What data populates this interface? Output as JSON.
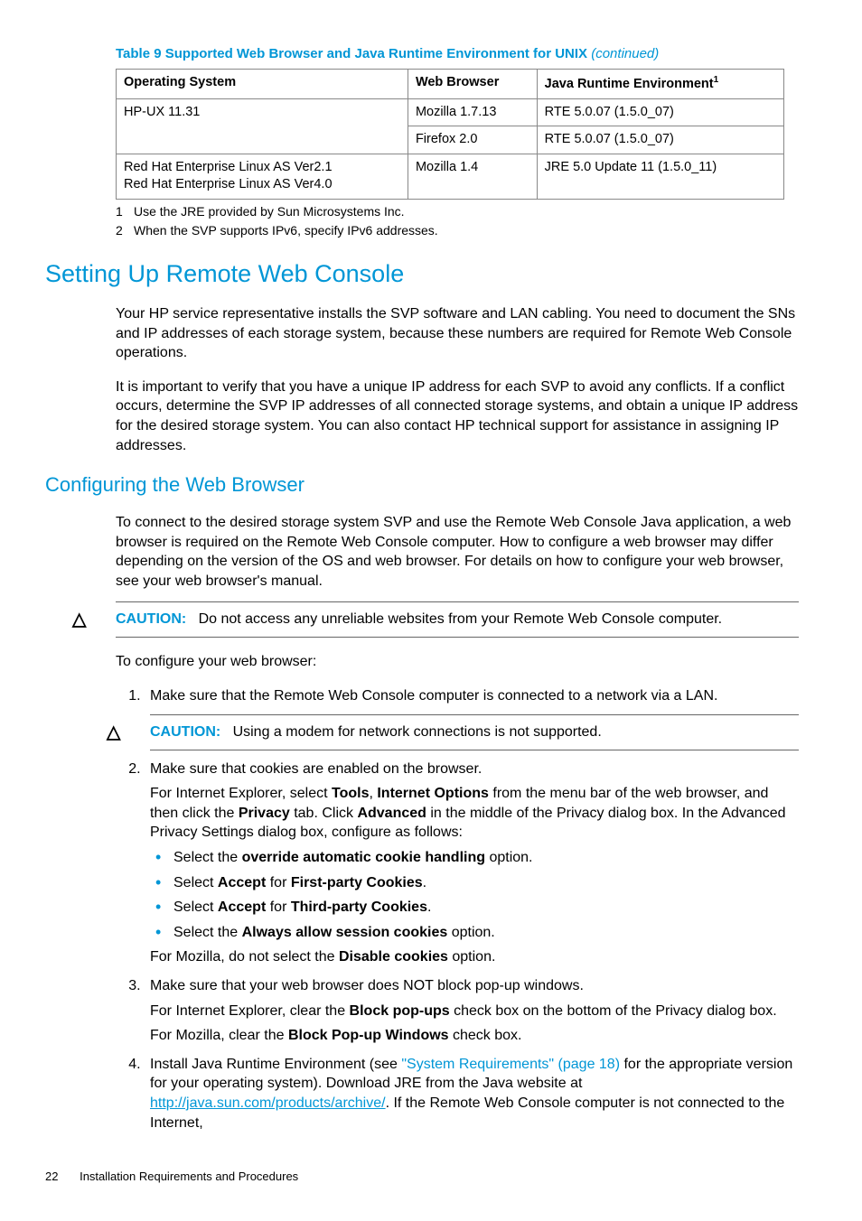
{
  "table": {
    "title": "Table 9 Supported Web Browser and Java Runtime Environment for UNIX",
    "continued": "(continued)",
    "headers": {
      "os": "Operating System",
      "browser": "Web Browser",
      "jre": "Java Runtime Environment",
      "jre_sup": "1"
    },
    "rows": {
      "r1_os": "HP-UX 11.31",
      "r1_browser": "Mozilla 1.7.13",
      "r1_jre": "RTE 5.0.07 (1.5.0_07)",
      "r2_browser": "Firefox 2.0",
      "r2_jre": "RTE 5.0.07 (1.5.0_07)",
      "r3_os_a": "Red Hat Enterprise Linux AS Ver2.1",
      "r3_os_b": "Red Hat Enterprise Linux AS Ver4.0",
      "r3_browser": "Mozilla 1.4",
      "r3_jre": "JRE 5.0 Update 11 (1.5.0_11)"
    }
  },
  "footnotes": {
    "n1": "1",
    "t1": "Use the JRE provided by Sun Microsystems Inc.",
    "n2": "2",
    "t2": "When the SVP supports IPv6, specify IPv6 addresses."
  },
  "h1": "Setting Up Remote Web Console",
  "para1": "Your HP service representative installs the SVP software and LAN cabling. You need to document the SNs and IP addresses of each storage system, because these numbers are required for Remote Web Console operations.",
  "para2": "It is important to verify that you have a unique IP address for each SVP to avoid any conflicts. If a conflict occurs, determine the SVP IP addresses of all connected storage systems, and obtain a unique IP address for the desired storage system. You can also contact HP technical support for assistance in assigning IP addresses.",
  "h2": "Configuring the Web Browser",
  "para3": "To connect to the desired storage system SVP and use the Remote Web Console Java application, a web browser is required on the Remote Web Console computer. How to configure a web browser may differ depending on the version of the OS and web browser. For details on how to configure your web browser, see your web browser's manual.",
  "caution": {
    "label": "CAUTION:",
    "text1": "Do not access any unreliable websites from your Remote Web Console computer.",
    "text2": "Using a modem for network connections is not supported."
  },
  "para4": "To configure your web browser:",
  "steps": {
    "s1": "Make sure that the Remote Web Console computer is connected to a network via a LAN.",
    "s2": "Make sure that cookies are enabled on the browser.",
    "s2_p1a": "For Internet Explorer, select ",
    "s2_p1b_tools": "Tools",
    "s2_p1c": ", ",
    "s2_p1d_io": "Internet Options",
    "s2_p1e": " from the menu bar of the web browser, and then click the ",
    "s2_p1f_priv": "Privacy",
    "s2_p1g": " tab. Click ",
    "s2_p1h_adv": "Advanced",
    "s2_p1i": " in the middle of the Privacy dialog box. In the Advanced Privacy Settings dialog box, configure as follows:",
    "b1a": "Select the ",
    "b1b": "override automatic cookie handling",
    "b1c": " option.",
    "b2a": "Select ",
    "b2b": "Accept",
    "b2c": " for ",
    "b2d": "First-party Cookies",
    "b2e": ".",
    "b3a": "Select ",
    "b3b": "Accept",
    "b3c": " for ",
    "b3d": "Third-party Cookies",
    "b3e": ".",
    "b4a": "Select the ",
    "b4b": "Always allow session cookies",
    "b4c": " option.",
    "s2_p2a": "For Mozilla, do not select the ",
    "s2_p2b": "Disable cookies",
    "s2_p2c": " option.",
    "s3": "Make sure that your web browser does NOT block pop-up windows.",
    "s3_p1a": "For Internet Explorer, clear the ",
    "s3_p1b": "Block pop-ups",
    "s3_p1c": " check box on the bottom of the Privacy dialog box.",
    "s3_p2a": "For Mozilla, clear the ",
    "s3_p2b": "Block Pop-up Windows",
    "s3_p2c": " check box.",
    "s4a": "Install Java Runtime Environment (see ",
    "s4b_link": "\"System Requirements\" (page 18)",
    "s4c": " for the appropriate version for your operating system). Download JRE from the Java website at ",
    "s4d_url": "http://java.sun.com/products/archive/",
    "s4e": ". If the Remote Web Console computer is not connected to the Internet,"
  },
  "footer": {
    "page": "22",
    "section": "Installation Requirements and Procedures"
  }
}
